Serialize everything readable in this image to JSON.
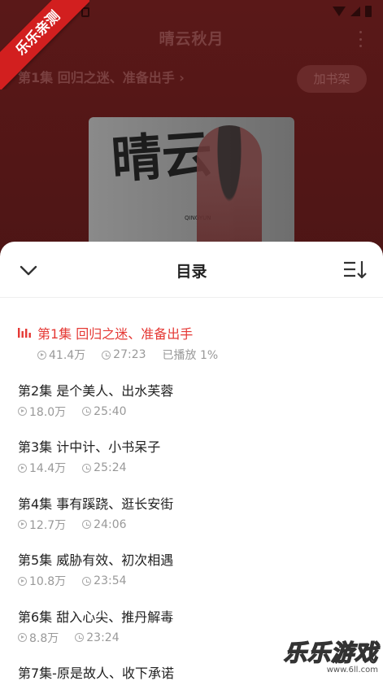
{
  "ribbon": {
    "label": "乐乐亲测"
  },
  "player": {
    "title": "晴云秋月",
    "current_episode_link": "第1集 回归之迷、准备出手",
    "add_to_shelf_label": "加书架",
    "cover_calligraphy": "晴云",
    "cover_subtitle": "QINGYUN"
  },
  "catalog": {
    "title": "目录",
    "episodes": [
      {
        "title": "第1集 回归之迷、准备出手",
        "plays": "41.4万",
        "duration": "27:23",
        "progress": "已播放 1%"
      },
      {
        "title": "第2集 是个美人、出水芙蓉",
        "plays": "18.0万",
        "duration": "25:40"
      },
      {
        "title": "第3集 计中计、小书呆子",
        "plays": "14.4万",
        "duration": "25:24"
      },
      {
        "title": "第4集 事有蹊跷、逛长安街",
        "plays": "12.7万",
        "duration": "24:06"
      },
      {
        "title": "第5集 威胁有效、初次相遇",
        "plays": "10.8万",
        "duration": "23:54"
      },
      {
        "title": "第6集 甜入心尖、推丹解毒",
        "plays": "8.8万",
        "duration": "23:24"
      },
      {
        "title": "第7集-原是故人、收下承诺"
      }
    ]
  },
  "watermark": {
    "main": "乐乐游戏",
    "url": "www.6ll.com"
  },
  "colors": {
    "accent": "#e53935",
    "ribbon": "#d21f1f",
    "backdrop": "#4a1414"
  }
}
